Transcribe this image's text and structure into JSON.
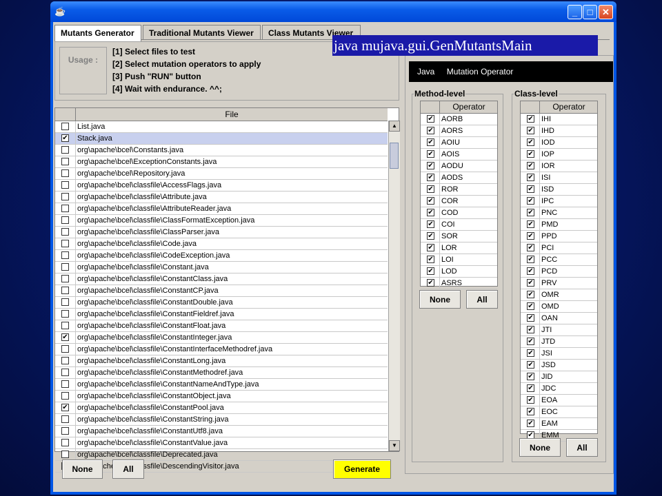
{
  "command_overlay": "java mujava.gui.GenMutantsMain",
  "window": {
    "app_icon": "java-cup-icon",
    "minimize": "_",
    "maximize": "□",
    "close": "✕"
  },
  "tabs": [
    {
      "label": "Mutants Generator",
      "active": true
    },
    {
      "label": "Traditional Mutants Viewer",
      "active": false
    },
    {
      "label": "Class Mutants Viewer",
      "active": false
    }
  ],
  "usage": {
    "button_label": "Usage :",
    "steps": [
      "[1] Select files to test",
      "[2] Select mutation operators to apply",
      "[3] Push \"RUN\" button",
      "[4] Wait with endurance. ^^;"
    ]
  },
  "file_table": {
    "header": "File",
    "rows": [
      {
        "name": "List.java",
        "checked": false,
        "selected": false
      },
      {
        "name": "Stack.java",
        "checked": true,
        "selected": true
      },
      {
        "name": "org\\apache\\bcel\\Constants.java",
        "checked": false,
        "selected": false
      },
      {
        "name": "org\\apache\\bcel\\ExceptionConstants.java",
        "checked": false,
        "selected": false
      },
      {
        "name": "org\\apache\\bcel\\Repository.java",
        "checked": false,
        "selected": false
      },
      {
        "name": "org\\apache\\bcel\\classfile\\AccessFlags.java",
        "checked": false,
        "selected": false
      },
      {
        "name": "org\\apache\\bcel\\classfile\\Attribute.java",
        "checked": false,
        "selected": false
      },
      {
        "name": "org\\apache\\bcel\\classfile\\AttributeReader.java",
        "checked": false,
        "selected": false
      },
      {
        "name": "org\\apache\\bcel\\classfile\\ClassFormatException.java",
        "checked": false,
        "selected": false
      },
      {
        "name": "org\\apache\\bcel\\classfile\\ClassParser.java",
        "checked": false,
        "selected": false
      },
      {
        "name": "org\\apache\\bcel\\classfile\\Code.java",
        "checked": false,
        "selected": false
      },
      {
        "name": "org\\apache\\bcel\\classfile\\CodeException.java",
        "checked": false,
        "selected": false
      },
      {
        "name": "org\\apache\\bcel\\classfile\\Constant.java",
        "checked": false,
        "selected": false
      },
      {
        "name": "org\\apache\\bcel\\classfile\\ConstantClass.java",
        "checked": false,
        "selected": false
      },
      {
        "name": "org\\apache\\bcel\\classfile\\ConstantCP.java",
        "checked": false,
        "selected": false
      },
      {
        "name": "org\\apache\\bcel\\classfile\\ConstantDouble.java",
        "checked": false,
        "selected": false
      },
      {
        "name": "org\\apache\\bcel\\classfile\\ConstantFieldref.java",
        "checked": false,
        "selected": false
      },
      {
        "name": "org\\apache\\bcel\\classfile\\ConstantFloat.java",
        "checked": false,
        "selected": false
      },
      {
        "name": "org\\apache\\bcel\\classfile\\ConstantInteger.java",
        "checked": true,
        "selected": false
      },
      {
        "name": "org\\apache\\bcel\\classfile\\ConstantInterfaceMethodref.java",
        "checked": false,
        "selected": false
      },
      {
        "name": "org\\apache\\bcel\\classfile\\ConstantLong.java",
        "checked": false,
        "selected": false
      },
      {
        "name": "org\\apache\\bcel\\classfile\\ConstantMethodref.java",
        "checked": false,
        "selected": false
      },
      {
        "name": "org\\apache\\bcel\\classfile\\ConstantNameAndType.java",
        "checked": false,
        "selected": false
      },
      {
        "name": "org\\apache\\bcel\\classfile\\ConstantObject.java",
        "checked": false,
        "selected": false
      },
      {
        "name": "org\\apache\\bcel\\classfile\\ConstantPool.java",
        "checked": true,
        "selected": false
      },
      {
        "name": "org\\apache\\bcel\\classfile\\ConstantString.java",
        "checked": false,
        "selected": false
      },
      {
        "name": "org\\apache\\bcel\\classfile\\ConstantUtf8.java",
        "checked": false,
        "selected": false
      },
      {
        "name": "org\\apache\\bcel\\classfile\\ConstantValue.java",
        "checked": false,
        "selected": false
      },
      {
        "name": "org\\apache\\bcel\\classfile\\Deprecated.java",
        "checked": false,
        "selected": false
      },
      {
        "name": "org\\apache\\bcel\\classfile\\DescendingVisitor.java",
        "checked": false,
        "selected": false
      }
    ]
  },
  "file_buttons": {
    "none": "None",
    "all": "All",
    "generate": "Generate"
  },
  "operator_tabs": {
    "java": "Java",
    "mutation_operator": "Mutation Operator"
  },
  "method_level": {
    "title": "Method-level",
    "header": "Operator",
    "operators": [
      "AORB",
      "AORS",
      "AOIU",
      "AOIS",
      "AODU",
      "AODS",
      "ROR",
      "COR",
      "COD",
      "COI",
      "SOR",
      "LOR",
      "LOI",
      "LOD",
      "ASRS"
    ],
    "none": "None",
    "all": "All"
  },
  "class_level": {
    "title": "Class-level",
    "header": "Operator",
    "operators": [
      "IHI",
      "IHD",
      "IOD",
      "IOP",
      "IOR",
      "ISI",
      "ISD",
      "IPC",
      "PNC",
      "PMD",
      "PPD",
      "PCI",
      "PCC",
      "PCD",
      "PRV",
      "OMR",
      "OMD",
      "OAN",
      "JTI",
      "JTD",
      "JSI",
      "JSD",
      "JID",
      "JDC",
      "EOA",
      "EOC",
      "EAM",
      "EMM"
    ],
    "none": "None",
    "all": "All"
  },
  "colors": {
    "generate_button": "#ffff00",
    "overlay_bg": "#1a1aa8",
    "selected_row": "#c8d0ee"
  }
}
